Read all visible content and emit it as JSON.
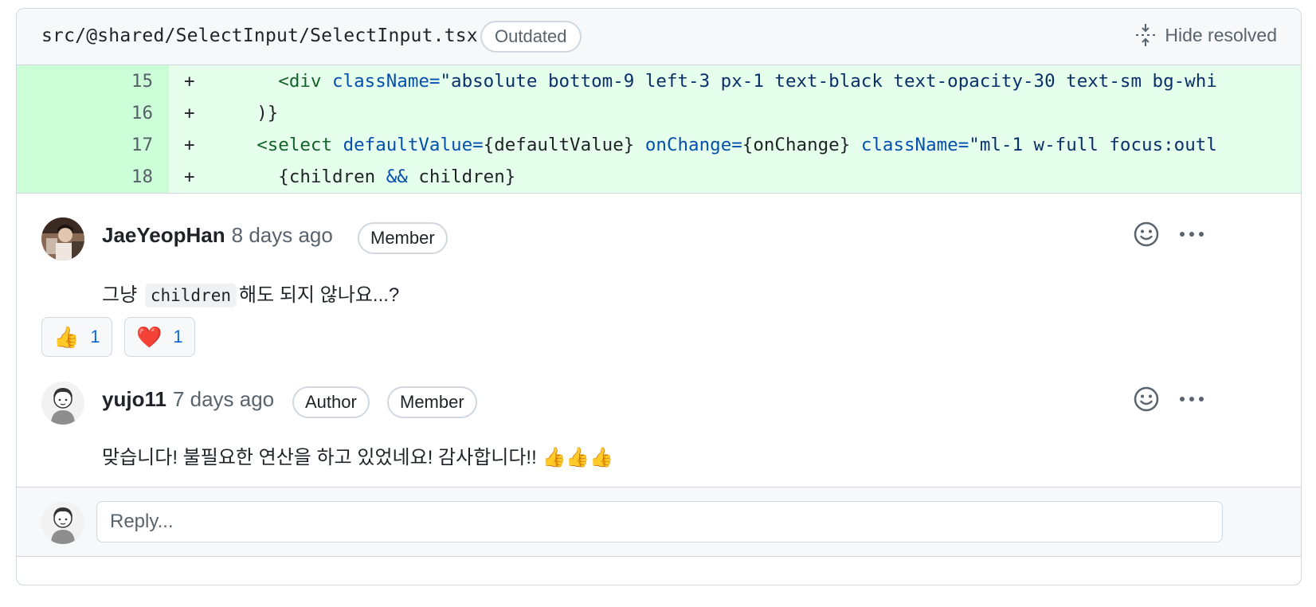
{
  "file": {
    "path": "src/@shared/SelectInput/SelectInput.tsx",
    "status_badge": "Outdated",
    "hide_resolved_label": "Hide resolved"
  },
  "diff": {
    "lines": [
      {
        "num": "15",
        "sign": "+",
        "indent": "      ",
        "parts": [
          [
            "tag",
            "<div"
          ],
          [
            "plain",
            " "
          ],
          [
            "attr",
            "className="
          ],
          [
            "str",
            "\"absolute bottom-9 left-3 px-1 text-black text-opacity-30 text-sm bg-whi"
          ]
        ]
      },
      {
        "num": "16",
        "sign": "+",
        "indent": "    ",
        "parts": [
          [
            "plain",
            ")}"
          ]
        ]
      },
      {
        "num": "17",
        "sign": "+",
        "indent": "    ",
        "parts": [
          [
            "tag",
            "<select"
          ],
          [
            "plain",
            " "
          ],
          [
            "attr",
            "defaultValue="
          ],
          [
            "plain",
            "{defaultValue} "
          ],
          [
            "attr",
            "onChange="
          ],
          [
            "plain",
            "{onChange} "
          ],
          [
            "attr",
            "className="
          ],
          [
            "str",
            "\"ml-1 w-full focus:outl"
          ]
        ]
      },
      {
        "num": "18",
        "sign": "+",
        "indent": "      ",
        "parts": [
          [
            "plain",
            "{children "
          ],
          [
            "attr",
            "&&"
          ],
          [
            "plain",
            " children}"
          ]
        ]
      }
    ]
  },
  "comments": [
    {
      "author": "JaeYeopHan",
      "time": "8 days ago",
      "badges": [
        "Member"
      ],
      "body_before": "그냥",
      "body_code": "children",
      "body_after": "해도 되지 않나요...?",
      "reactions": [
        {
          "emoji": "👍",
          "count": "1",
          "icon": "thumbs-up-icon"
        },
        {
          "emoji": "❤️",
          "count": "1",
          "icon": "heart-icon"
        }
      ]
    },
    {
      "author": "yujo11",
      "time": "7 days ago",
      "badges": [
        "Author",
        "Member"
      ],
      "body": "맞습니다! 불필요한 연산을 하고 있었네요! 감사합니다!! 👍👍👍"
    }
  ],
  "reply": {
    "placeholder": "Reply..."
  },
  "colors": {
    "addition_bg": "#e6ffec",
    "addition_gutter": "#ccffd8",
    "link_blue": "#0969da",
    "border": "#d0d7de"
  }
}
